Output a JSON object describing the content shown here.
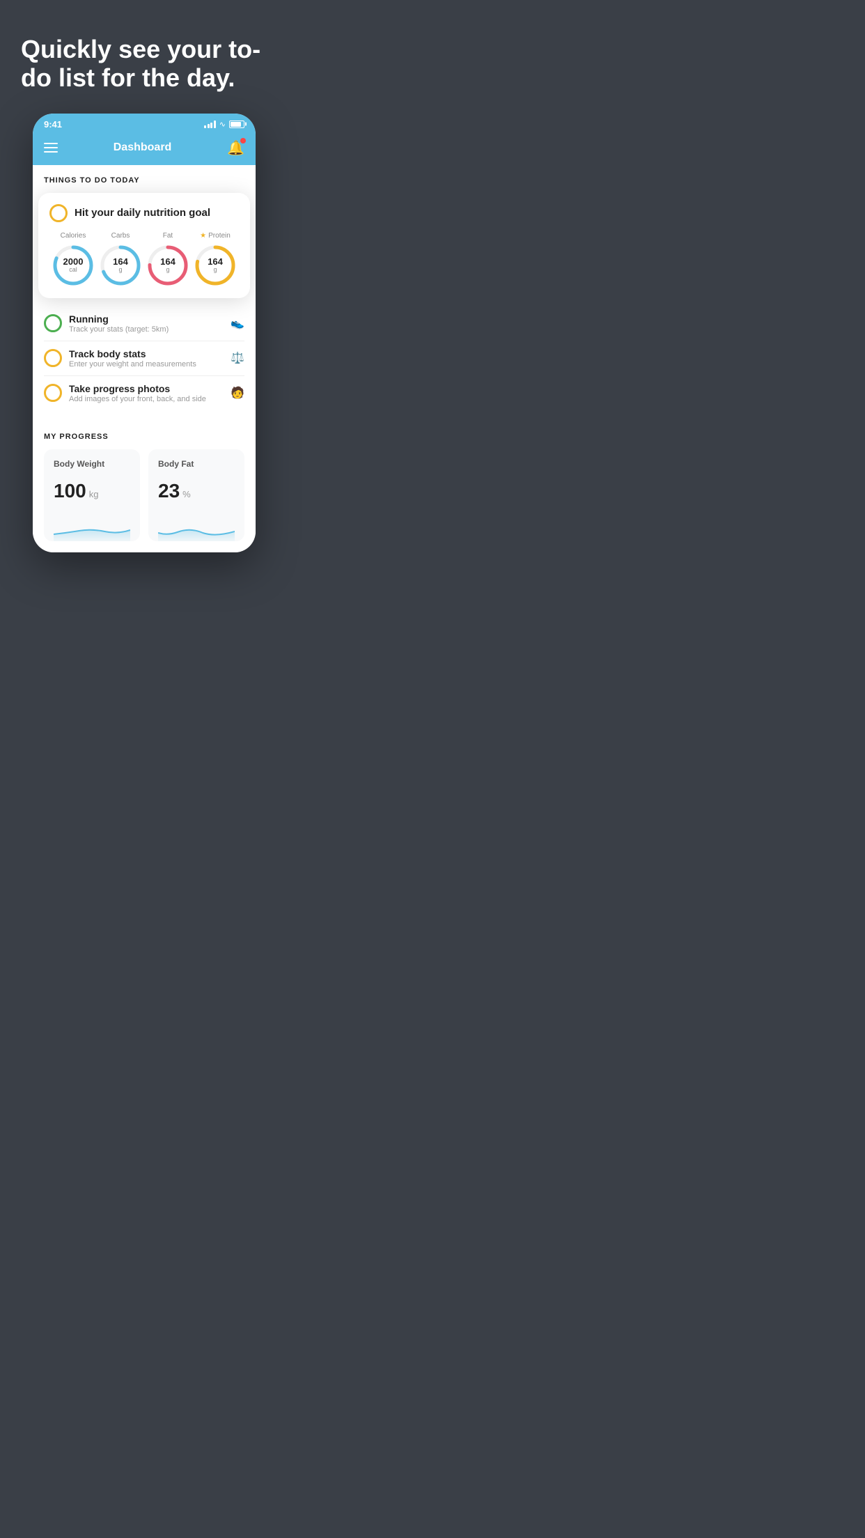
{
  "hero": {
    "title": "Quickly see your to-do list for the day."
  },
  "phone": {
    "status": {
      "time": "9:41"
    },
    "nav": {
      "title": "Dashboard"
    },
    "sections": {
      "todo_title": "THINGS TO DO TODAY",
      "progress_title": "MY PROGRESS"
    },
    "nutrition_card": {
      "circle_label": "",
      "title": "Hit your daily nutrition goal",
      "items": [
        {
          "label": "Calories",
          "value": "2000",
          "unit": "cal",
          "color": "blue",
          "starred": false
        },
        {
          "label": "Carbs",
          "value": "164",
          "unit": "g",
          "color": "blue",
          "starred": false
        },
        {
          "label": "Fat",
          "value": "164",
          "unit": "g",
          "color": "red",
          "starred": false
        },
        {
          "label": "Protein",
          "value": "164",
          "unit": "g",
          "color": "yellow",
          "starred": true
        }
      ]
    },
    "todo_items": [
      {
        "label": "Running",
        "sublabel": "Track your stats (target: 5km)",
        "circle_color": "green",
        "icon": "shoe"
      },
      {
        "label": "Track body stats",
        "sublabel": "Enter your weight and measurements",
        "circle_color": "yellow",
        "icon": "scale"
      },
      {
        "label": "Take progress photos",
        "sublabel": "Add images of your front, back, and side",
        "circle_color": "yellow",
        "icon": "person"
      }
    ],
    "progress": {
      "body_weight": {
        "title": "Body Weight",
        "value": "100",
        "unit": "kg"
      },
      "body_fat": {
        "title": "Body Fat",
        "value": "23",
        "unit": "%"
      }
    }
  }
}
